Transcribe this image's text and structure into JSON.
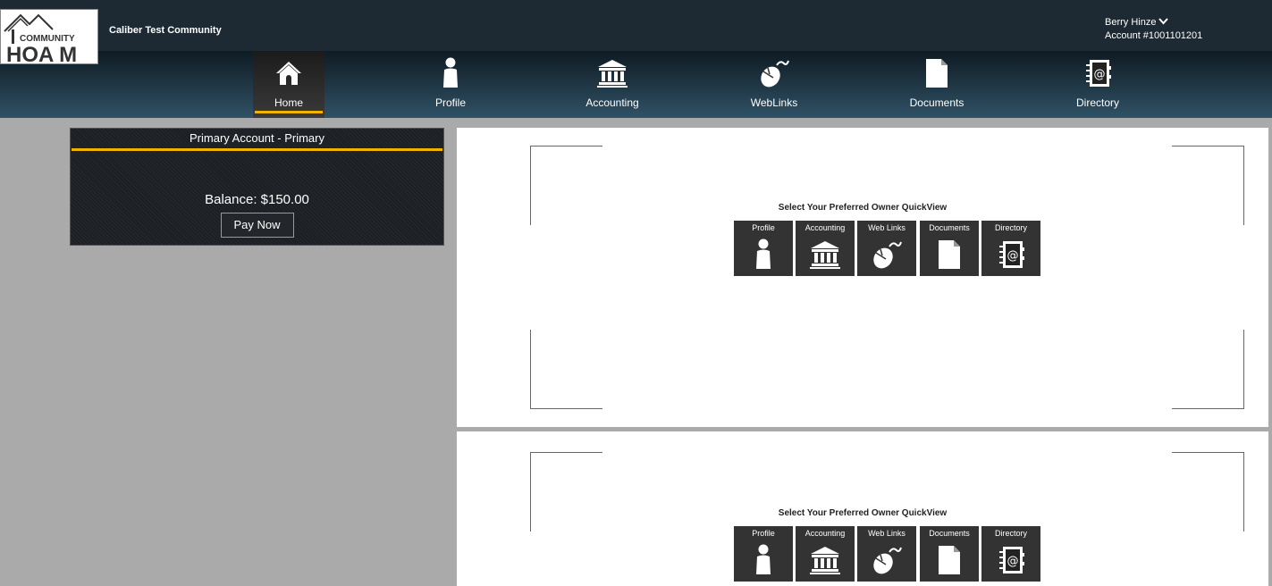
{
  "header": {
    "logo_text_top": "COMMUNITY",
    "logo_text_bottom": "HOA M",
    "community_name": "Caliber Test Community",
    "user_name": "Berry Hinze",
    "account_number": "Account #1001101201"
  },
  "nav": {
    "items": [
      {
        "label": "Home",
        "icon": "home-icon",
        "active": true
      },
      {
        "label": "Profile",
        "icon": "person-icon"
      },
      {
        "label": "Accounting",
        "icon": "bank-icon"
      },
      {
        "label": "WebLinks",
        "icon": "mouse-icon"
      },
      {
        "label": "Documents",
        "icon": "document-icon"
      },
      {
        "label": "Directory",
        "icon": "address-book-icon"
      }
    ]
  },
  "account": {
    "title": "Primary Account - Primary",
    "balance": "Balance: $150.00",
    "pay_label": "Pay Now"
  },
  "quickview": {
    "title": "Select Your Preferred Owner QuickView",
    "tiles": [
      {
        "label": "Profile",
        "icon": "person-icon"
      },
      {
        "label": "Accounting",
        "icon": "bank-icon"
      },
      {
        "label": "Web Links",
        "icon": "mouse-icon"
      },
      {
        "label": "Documents",
        "icon": "document-icon"
      },
      {
        "label": "Directory",
        "icon": "address-book-icon"
      }
    ]
  },
  "colors": {
    "accent": "#f0b400",
    "topbar": "#1d2a33",
    "tile": "#333333",
    "background": "#a9aaa9"
  }
}
